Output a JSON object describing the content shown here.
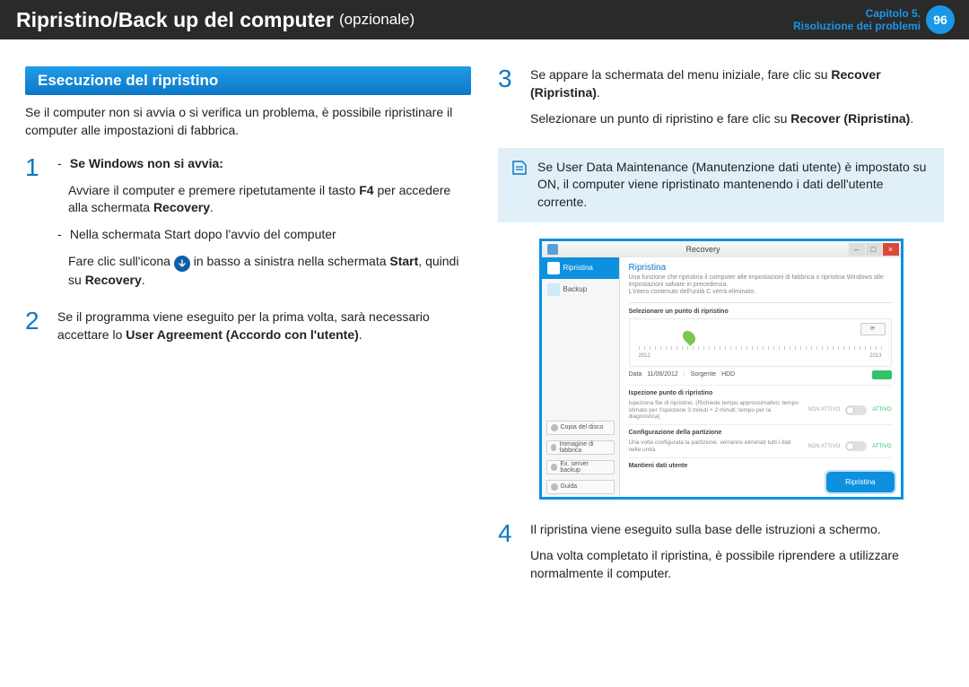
{
  "header": {
    "title": "Ripristino/Back up del computer",
    "subtitle": "(opzionale)",
    "chapter_line1": "Capitolo 5.",
    "chapter_line2": "Risoluzione dei problemi",
    "page_number": "96"
  },
  "section": {
    "heading": "Esecuzione del ripristino"
  },
  "intro": "Se il computer non si avvia o si verifica un problema, è possibile ripristinare il computer alle impostazioni di fabbrica.",
  "step1": {
    "bullet1_lead": "Se Windows non si avvia:",
    "bullet1_body_a": "Avviare il computer e premere ripetutamente il tasto ",
    "bullet1_body_key": "F4",
    "bullet1_body_b": " per accedere alla schermata ",
    "bullet1_body_recovery": "Recovery",
    "bullet2": "Nella schermata Start dopo l'avvio del computer",
    "bullet2_line2_a": "Fare clic sull'icona ",
    "bullet2_line2_b": " in basso a sinistra nella schermata ",
    "bullet2_line2_bold1": "Start",
    "bullet2_line2_c": ", quindi su ",
    "bullet2_line2_bold2": "Recovery"
  },
  "step2": {
    "a": "Se il programma viene eseguito per la prima volta, sarà necessario accettare lo ",
    "bold": "User Agreement (Accordo con l'utente)",
    "b": "."
  },
  "step3": {
    "a": "Se appare la schermata del menu iniziale, fare clic su ",
    "bold1": "Recover (Ripristina)",
    "b": ".",
    "c": "Selezionare un punto di ripristino e fare clic su  ",
    "bold2": "Recover (Ripristina)",
    "d": "."
  },
  "note": "Se User Data Maintenance (Manutenzione dati utente) è impostato su ON, il computer viene ripristinato mantenendo i dati dell'utente corrente.",
  "step4": {
    "a": "Il ripristina viene eseguito sulla base delle istruzioni a schermo.",
    "b": "Una volta completato il ripristina, è possibile riprendere a utilizzare normalmente il computer."
  },
  "app": {
    "title": "Recovery",
    "side": {
      "tab_recover": "Ripristina",
      "tab_backup": "Backup",
      "btn_copydisk": "Copia del disco",
      "btn_factory": "Immagine di fabbrica",
      "btn_exsrv": "Ex. server backup",
      "btn_guide": "Guida"
    },
    "main": {
      "heading": "Ripristina",
      "desc1": "Una funzione che ripristina il computer alle impostazioni di fabbrica o ripristina Windows alle impostazioni salvate in precedenza.",
      "desc2": "L'intero contenuto dell'unità C verrà eliminato.",
      "select_title": "Selezionare un punto di ripristino",
      "factory_btn": "⟳",
      "year_left": "2012",
      "year_right": "2013",
      "data_label": "Data",
      "data_value": "11/06/2012",
      "source_label": "Sorgente",
      "source_value": "HDD",
      "inspect_title": "Ispezione punto di ripristino",
      "inspect_desc": "Ispeziona file di ripristino. (Richiede tempo approssimativo; tempo stimato per l'ispezione 3 minuti + 2 minuti; tempo per la diagnostica)",
      "off": "NON ATTIVO",
      "on": "ATTIVO",
      "config_title": "Configurazione della partizione",
      "config_desc": "Una volta configurata la partizione, verranno eliminati tutti i dati nelle unità.",
      "userdata_title": "Mantieni dati utente",
      "cta": "Ripristina"
    }
  }
}
